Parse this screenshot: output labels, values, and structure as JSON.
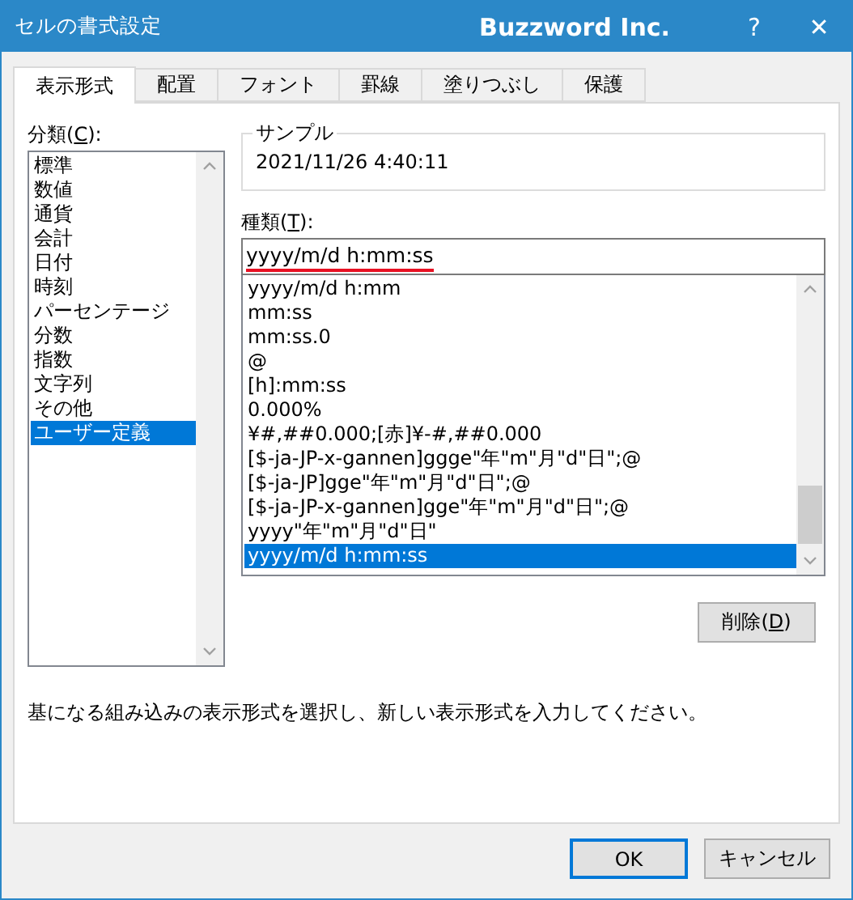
{
  "window": {
    "title": "セルの書式設定",
    "brand": "Buzzword Inc.",
    "help": "?",
    "close": "✕"
  },
  "tabs": [
    {
      "label": "表示形式",
      "selected": true
    },
    {
      "label": "配置",
      "selected": false
    },
    {
      "label": "フォント",
      "selected": false
    },
    {
      "label": "罫線",
      "selected": false
    },
    {
      "label": "塗りつぶし",
      "selected": false
    },
    {
      "label": "保護",
      "selected": false
    }
  ],
  "category": {
    "label": {
      "before": "分類(",
      "key": "C",
      "after": "):"
    },
    "items": [
      {
        "label": "標準",
        "selected": false
      },
      {
        "label": "数値",
        "selected": false
      },
      {
        "label": "通貨",
        "selected": false
      },
      {
        "label": "会計",
        "selected": false
      },
      {
        "label": "日付",
        "selected": false
      },
      {
        "label": "時刻",
        "selected": false
      },
      {
        "label": "パーセンテージ",
        "selected": false
      },
      {
        "label": "分数",
        "selected": false
      },
      {
        "label": "指数",
        "selected": false
      },
      {
        "label": "文字列",
        "selected": false
      },
      {
        "label": "その他",
        "selected": false
      },
      {
        "label": "ユーザー定義",
        "selected": true
      }
    ]
  },
  "sample": {
    "label": "サンプル",
    "value": "2021/11/26 4:40:11"
  },
  "type": {
    "label": {
      "before": "種類(",
      "key": "T",
      "after": "):"
    },
    "value": "yyyy/m/d h:mm:ss",
    "items": [
      {
        "label": "yyyy/m/d h:mm",
        "selected": false
      },
      {
        "label": "mm:ss",
        "selected": false
      },
      {
        "label": "mm:ss.0",
        "selected": false
      },
      {
        "label": "@",
        "selected": false
      },
      {
        "label": "[h]:mm:ss",
        "selected": false
      },
      {
        "label": "0.000%",
        "selected": false
      },
      {
        "label": "¥#,##0.000;[赤]¥-#,##0.000",
        "selected": false
      },
      {
        "label": "[$-ja-JP-x-gannen]ggge\"年\"m\"月\"d\"日\";@",
        "selected": false
      },
      {
        "label": "[$-ja-JP]gge\"年\"m\"月\"d\"日\";@",
        "selected": false
      },
      {
        "label": "[$-ja-JP-x-gannen]gge\"年\"m\"月\"d\"日\";@",
        "selected": false
      },
      {
        "label": "yyyy\"年\"m\"月\"d\"日\"",
        "selected": false
      },
      {
        "label": "yyyy/m/d h:mm:ss",
        "selected": true
      }
    ]
  },
  "delete_button": {
    "before": "削除(",
    "key": "D",
    "after": ")"
  },
  "description": "基になる組み込みの表示形式を選択し、新しい表示形式を入力してください。",
  "buttons": [
    {
      "label": "OK",
      "default": true
    },
    {
      "label": "キャンセル",
      "default": false
    }
  ]
}
